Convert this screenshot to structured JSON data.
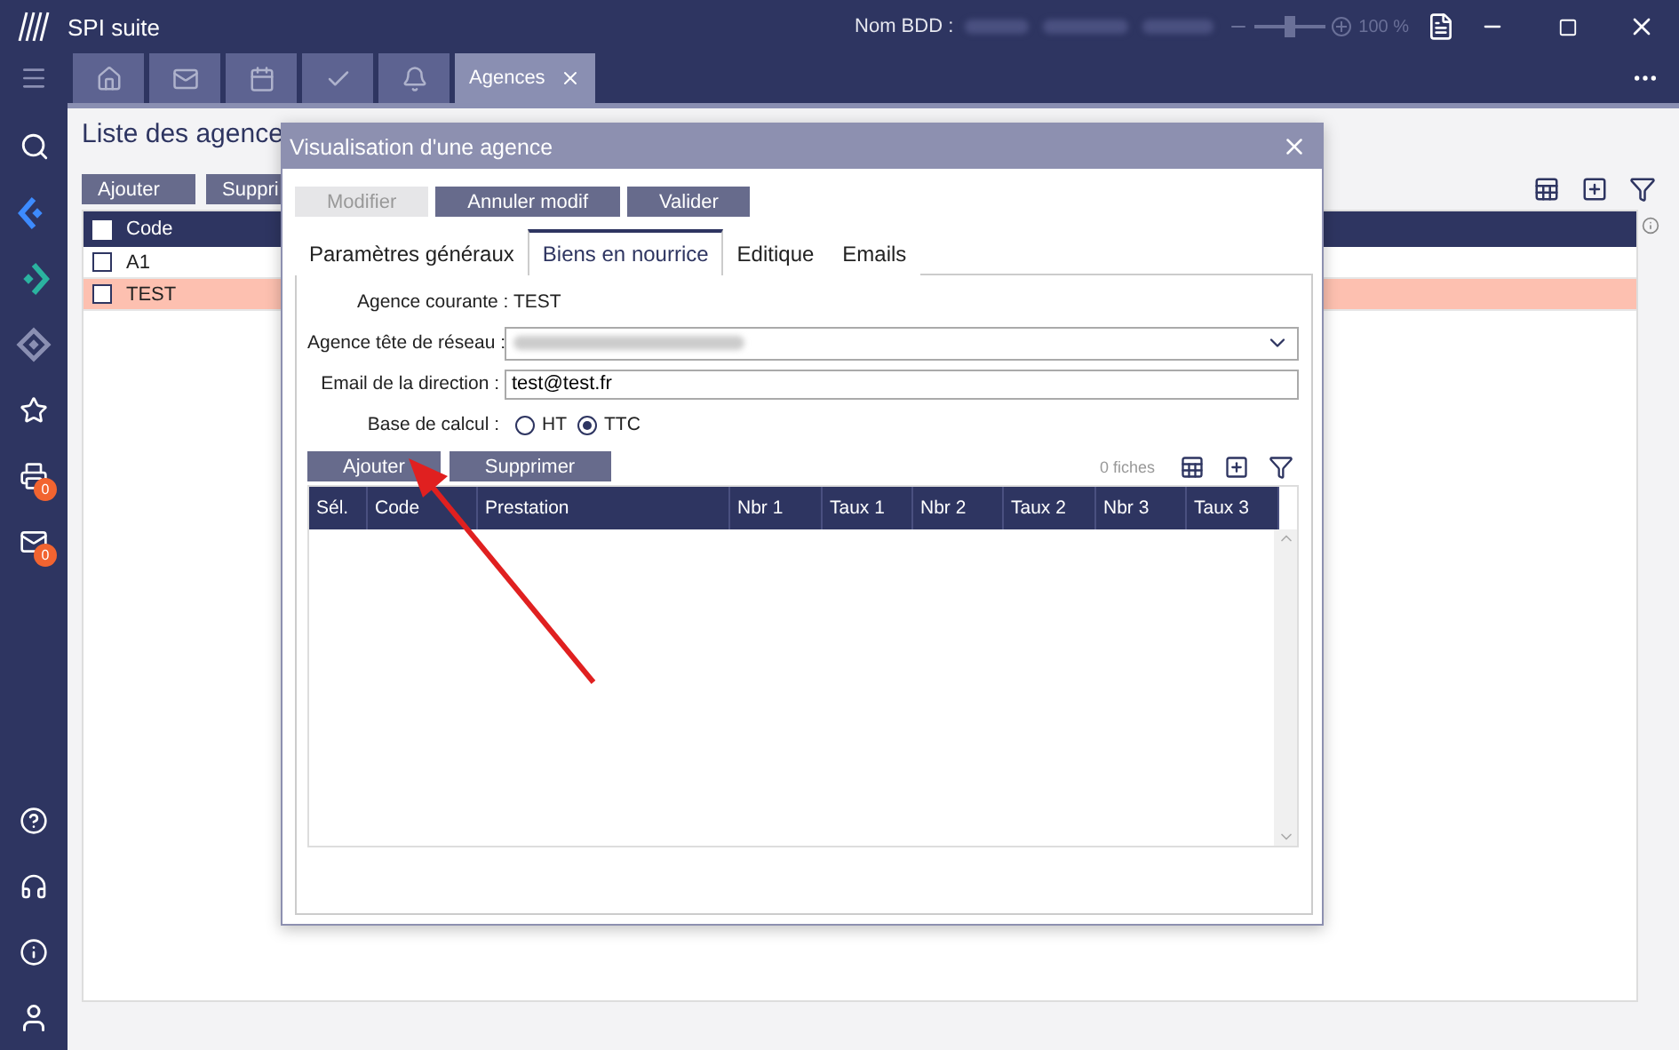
{
  "window": {
    "title": "SPI suite",
    "db_label": "Nom BDD :",
    "zoom": "100 %",
    "zoom_slider": {
      "level": 0.5
    }
  },
  "tabs": [
    {
      "kind": "home",
      "selected": false
    },
    {
      "kind": "mail",
      "selected": false
    },
    {
      "kind": "calendar",
      "selected": false
    },
    {
      "kind": "check",
      "selected": false
    },
    {
      "kind": "bell",
      "selected": false
    },
    {
      "kind": "text",
      "label": "Agences",
      "selected": true
    }
  ],
  "sidebar": {
    "badges": [
      {
        "kind": "print",
        "count": "0"
      },
      {
        "kind": "mail",
        "count": "0"
      }
    ]
  },
  "page": {
    "title": "Liste des agence",
    "buttons": [
      "Ajouter",
      "Suppri"
    ],
    "table": {
      "select_all_checked": false,
      "columns": [
        "Code"
      ],
      "rows": [
        {
          "code": "A1",
          "checked": false,
          "selected": false
        },
        {
          "code": "TEST",
          "checked": false,
          "selected": true
        }
      ]
    }
  },
  "dialog": {
    "title": "Visualisation d'une agence",
    "buttons": [
      {
        "label": "Modifier",
        "disabled": true
      },
      {
        "label": "Annuler modif",
        "disabled": false
      },
      {
        "label": "Valider",
        "disabled": false
      }
    ],
    "tabs": [
      {
        "label": "Paramètres généraux",
        "selected": false
      },
      {
        "label": "Biens en nourrice",
        "selected": true
      },
      {
        "label": "Editique",
        "selected": false
      },
      {
        "label": "Emails",
        "selected": false
      }
    ],
    "current_label": "Agence courante : TEST",
    "network_label": "Agence tête de réseau :",
    "email_label": "Email de la direction :",
    "email_value": "test@test.fr",
    "calc_label": "Base de calcul :",
    "calc_options": [
      {
        "label": "HT",
        "selected": false
      },
      {
        "label": "TTC",
        "selected": true
      }
    ],
    "sub_buttons": [
      "Ajouter",
      "Supprimer"
    ],
    "count": "0 fiches",
    "columns": [
      "Sél.",
      "Code",
      "Prestation",
      "Nbr 1",
      "Taux 1",
      "Nbr 2",
      "Taux 2",
      "Nbr 3",
      "Taux 3"
    ]
  }
}
